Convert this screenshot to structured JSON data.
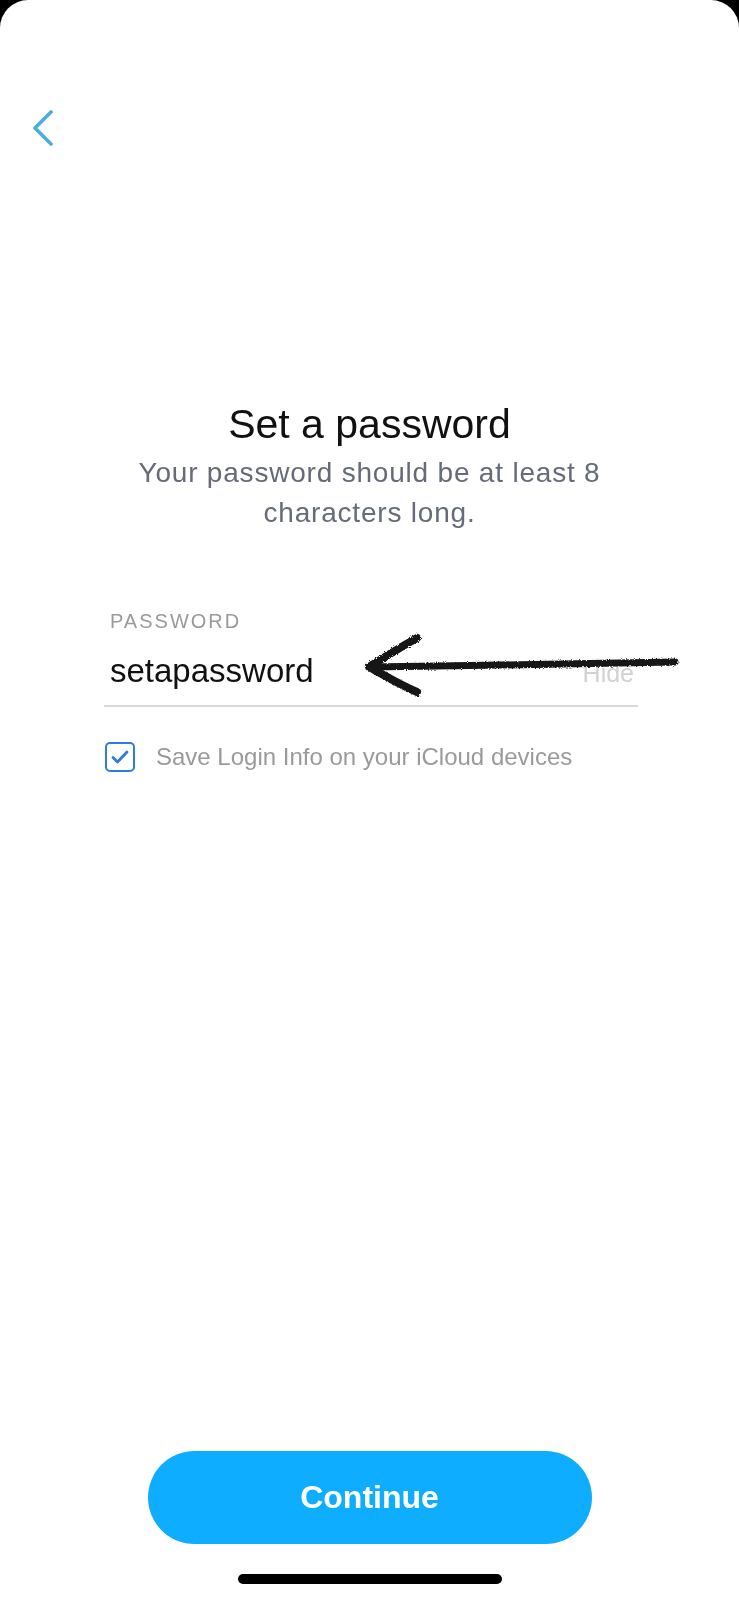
{
  "title": "Set a password",
  "subtitle": "Your password should be at least 8 characters long.",
  "password_field": {
    "label": "PASSWORD",
    "value": "setapassword",
    "toggle": "Hide"
  },
  "save_login": {
    "label": "Save Login Info on your iCloud devices",
    "checked": true
  },
  "primary_button": "Continue"
}
